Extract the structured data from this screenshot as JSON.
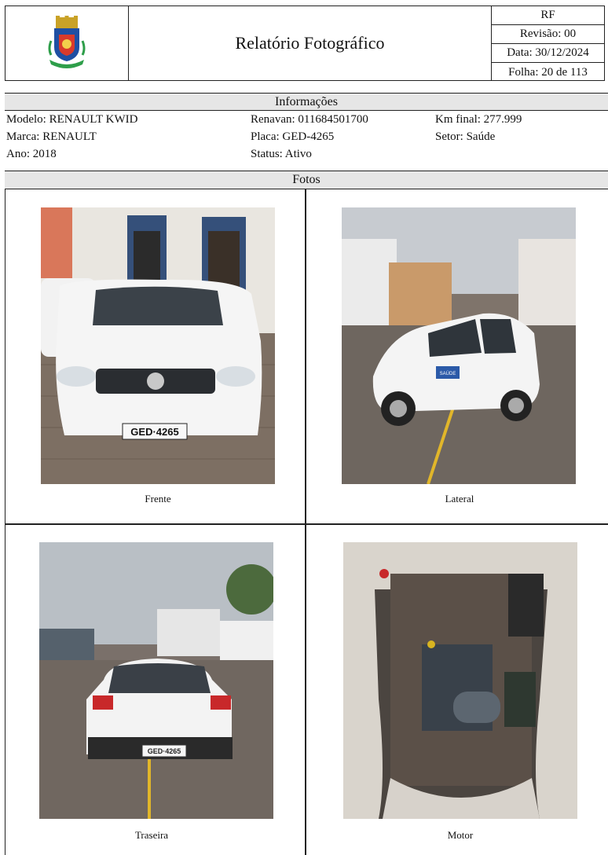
{
  "header": {
    "title": "Relatório Fotográfico",
    "code": "RF",
    "revisao": "Revisão: 00",
    "data": "Data: 30/12/2024",
    "folha": "Folha: 20 de 113"
  },
  "info": {
    "section_label": "Informações",
    "modelo": "Modelo: RENAULT KWID",
    "marca": "Marca: RENAULT",
    "ano": "Ano: 2018",
    "renavan": "Renavan: 011684501700",
    "placa": "Placa: GED-4265",
    "status": "Status: Ativo",
    "km_final": "Km final: 277.999",
    "setor": "Setor: Saúde"
  },
  "fotos": {
    "section_label": "Fotos",
    "items": [
      {
        "caption": "Frente",
        "plate": "GED·4265"
      },
      {
        "caption": "Lateral",
        "door_label": "SAÚDE"
      },
      {
        "caption": "Traseira",
        "plate": "GED·4265"
      },
      {
        "caption": "Motor"
      }
    ]
  },
  "colors": {
    "band_gray": "#e6e6e6",
    "border": "#222222"
  }
}
